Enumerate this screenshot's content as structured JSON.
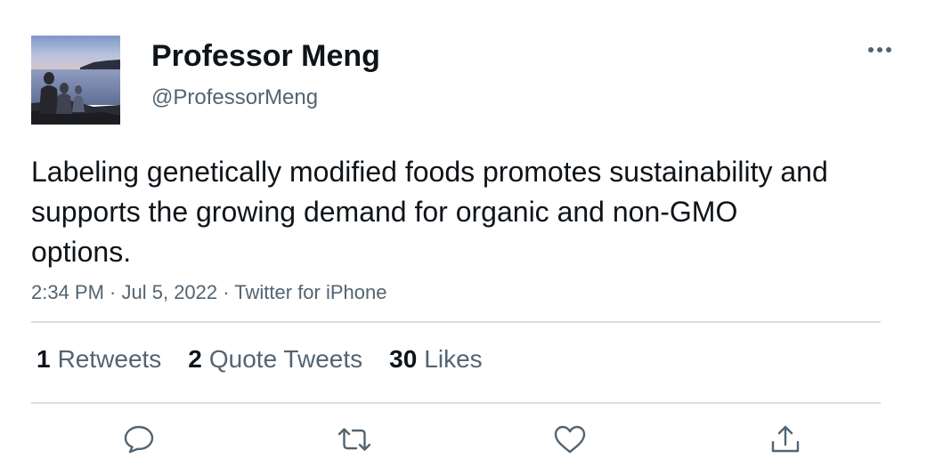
{
  "author": {
    "display_name": "Professor Meng",
    "handle": "@ProfessorMeng",
    "avatar": "lakeside-sunset-photo"
  },
  "tweet": {
    "text": "Labeling genetically modified foods promotes sustainability and supports the growing demand for organic and non-GMO options.",
    "time": "2:34 PM",
    "sep1": " · ",
    "date": "Jul 5, 2022",
    "sep2": " · ",
    "source": "Twitter for iPhone"
  },
  "stats": {
    "retweets": {
      "count": "1",
      "label": "Retweets"
    },
    "quotes": {
      "count": "2",
      "label": "Quote Tweets"
    },
    "likes": {
      "count": "30",
      "label": "Likes"
    }
  },
  "icons": {
    "more": "more-horizontal-icon",
    "reply": "reply-icon",
    "retweet": "retweet-icon",
    "like": "like-icon",
    "share": "share-icon"
  },
  "colors": {
    "text": "#0f1419",
    "secondary": "#536471",
    "divider": "#dadde1"
  }
}
